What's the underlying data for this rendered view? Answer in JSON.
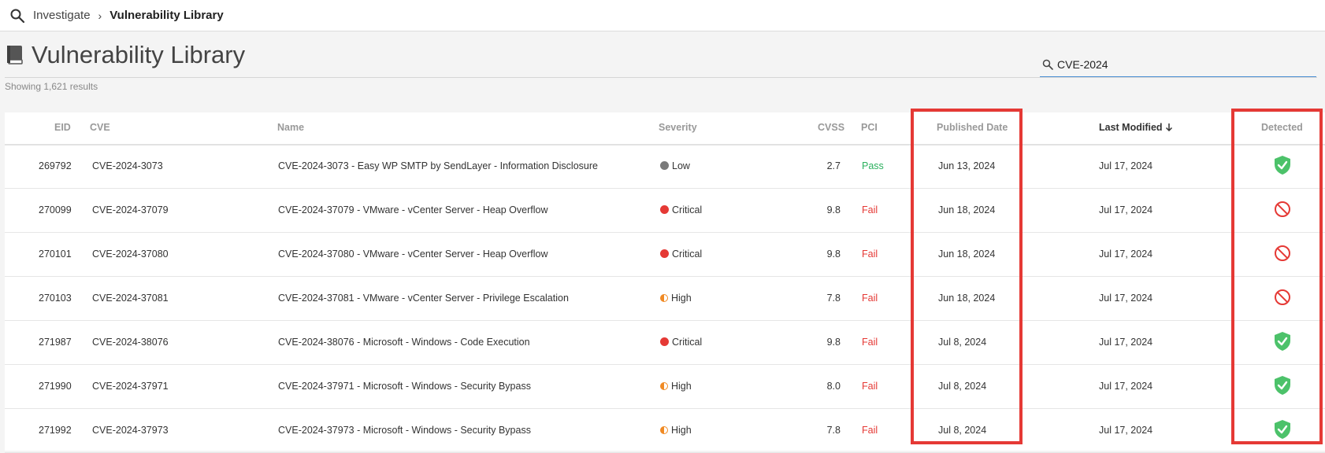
{
  "breadcrumb": {
    "root": "Investigate",
    "separator": "›",
    "current": "Vulnerability Library"
  },
  "page": {
    "title": "Vulnerability Library",
    "result_count": "Showing 1,621 results"
  },
  "search": {
    "value": "CVE-2024",
    "placeholder": ""
  },
  "table": {
    "columns": {
      "eid": "EID",
      "cve": "CVE",
      "name": "Name",
      "severity": "Severity",
      "cvss": "CVSS",
      "pci": "PCI",
      "published": "Published Date",
      "modified": "Last Modified",
      "modified_sort": "descending",
      "detected": "Detected"
    },
    "rows": [
      {
        "eid": "269792",
        "cve": "CVE-2024-3073",
        "name": "CVE-2024-3073 - Easy WP SMTP by SendLayer - Information Disclosure",
        "severity": "Low",
        "severity_icon": "grey-dot",
        "cvss": "2.7",
        "pci": "Pass",
        "published": "Jun 13, 2024",
        "modified": "Jul 17, 2024",
        "detected": "shield-check-icon"
      },
      {
        "eid": "270099",
        "cve": "CVE-2024-37079",
        "name": "CVE-2024-37079 - VMware - vCenter Server - Heap Overflow",
        "severity": "Critical",
        "severity_icon": "red-dot",
        "cvss": "9.8",
        "pci": "Fail",
        "published": "Jun 18, 2024",
        "modified": "Jul 17, 2024",
        "detected": "not-detected-icon"
      },
      {
        "eid": "270101",
        "cve": "CVE-2024-37080",
        "name": "CVE-2024-37080 - VMware - vCenter Server - Heap Overflow",
        "severity": "Critical",
        "severity_icon": "red-dot",
        "cvss": "9.8",
        "pci": "Fail",
        "published": "Jun 18, 2024",
        "modified": "Jul 17, 2024",
        "detected": "not-detected-icon"
      },
      {
        "eid": "270103",
        "cve": "CVE-2024-37081",
        "name": "CVE-2024-37081 - VMware - vCenter Server - Privilege Escalation",
        "severity": "High",
        "severity_icon": "half-orange-dot",
        "cvss": "7.8",
        "pci": "Fail",
        "published": "Jun 18, 2024",
        "modified": "Jul 17, 2024",
        "detected": "not-detected-icon"
      },
      {
        "eid": "271987",
        "cve": "CVE-2024-38076",
        "name": "CVE-2024-38076 - Microsoft - Windows - Code Execution",
        "severity": "Critical",
        "severity_icon": "red-dot",
        "cvss": "9.8",
        "pci": "Fail",
        "published": "Jul 8, 2024",
        "modified": "Jul 17, 2024",
        "detected": "shield-check-icon"
      },
      {
        "eid": "271990",
        "cve": "CVE-2024-37971",
        "name": "CVE-2024-37971 - Microsoft - Windows - Security Bypass",
        "severity": "High",
        "severity_icon": "half-orange-dot",
        "cvss": "8.0",
        "pci": "Fail",
        "published": "Jul 8, 2024",
        "modified": "Jul 17, 2024",
        "detected": "shield-check-icon"
      },
      {
        "eid": "271992",
        "cve": "CVE-2024-37973",
        "name": "CVE-2024-37973 - Microsoft - Windows - Security Bypass",
        "severity": "High",
        "severity_icon": "half-orange-dot",
        "cvss": "7.8",
        "pci": "Fail",
        "published": "Jul 8, 2024",
        "modified": "Jul 17, 2024",
        "detected": "shield-check-icon"
      }
    ]
  },
  "colors": {
    "accent_blue": "#4b8fd4",
    "pass_green": "#2bb05e",
    "fail_red": "#e53935",
    "critical_red": "#e53935",
    "high_orange": "#f08a24",
    "low_grey": "#7a7a7a",
    "detected_green": "#4cc26a",
    "highlight_red": "#e53935"
  }
}
